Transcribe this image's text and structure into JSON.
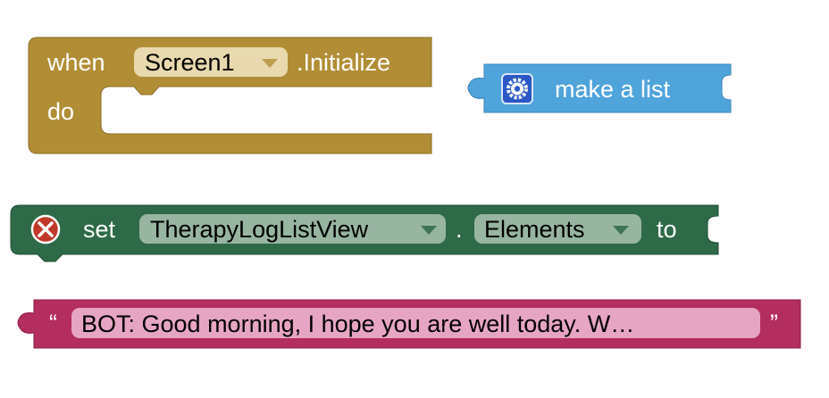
{
  "blocks": {
    "event": {
      "when_label": "when",
      "component": "Screen1",
      "event_name": ".Initialize",
      "do_label": "do",
      "color": "#b18e35"
    },
    "make_list": {
      "label": "make a list",
      "mutator_icon": "gear-icon",
      "color": "#4fa4db"
    },
    "setter": {
      "set_label": "set",
      "component": "TherapyLogListView",
      "dot": ".",
      "property": "Elements",
      "to_label": "to",
      "error_icon": "error-x-icon",
      "color": "#2e6a47"
    },
    "text": {
      "open_quote": "“",
      "value": "BOT: Good morning, I hope you are well today.  W…",
      "close_quote": "”",
      "color": "#b32d5e"
    }
  }
}
